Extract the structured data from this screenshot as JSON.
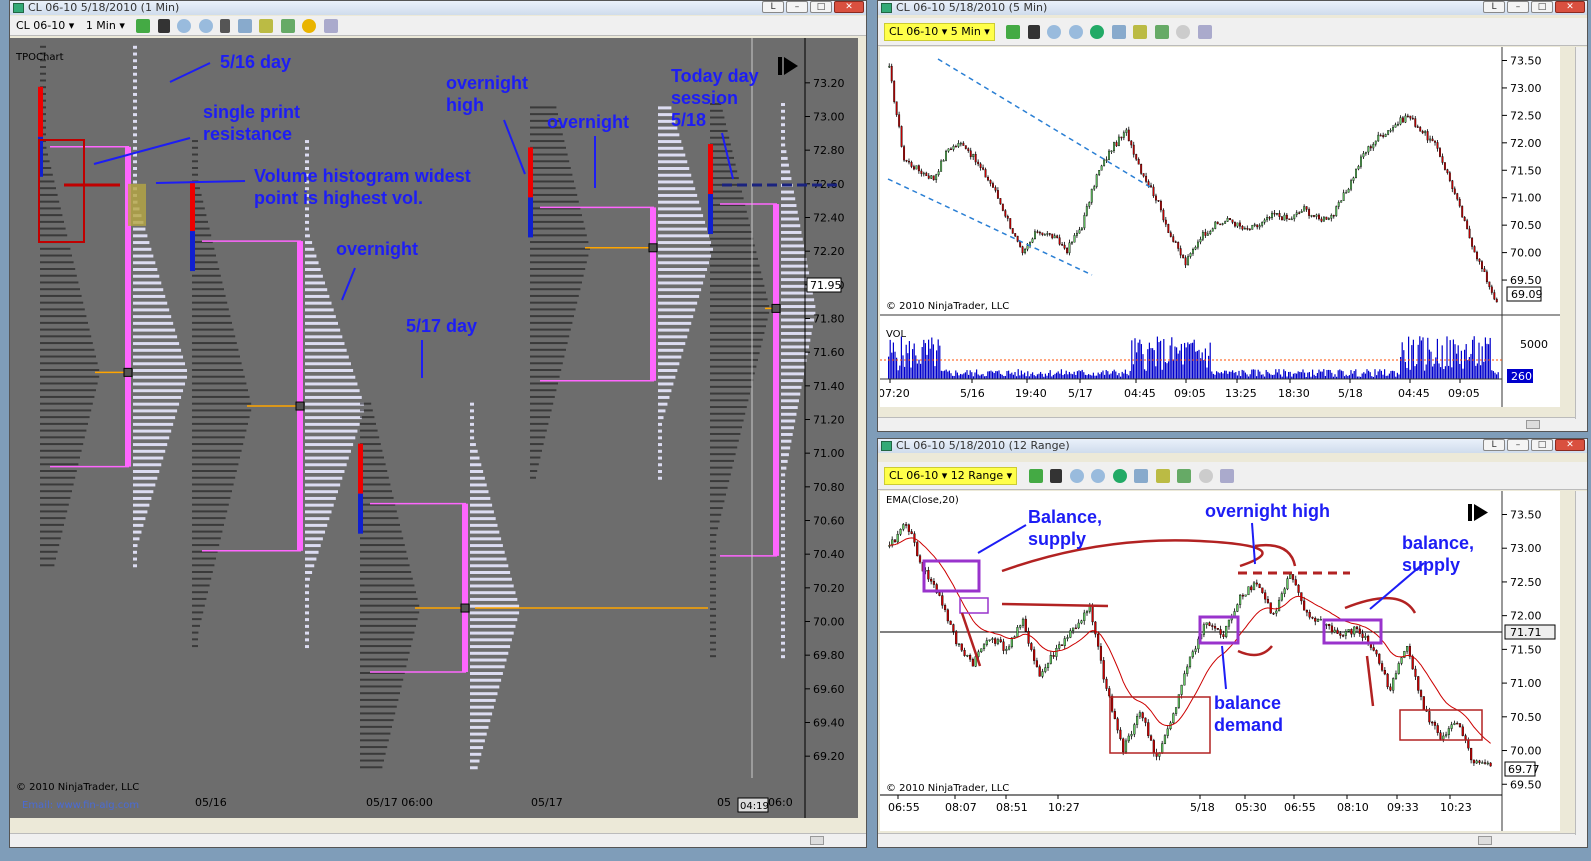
{
  "window_left": {
    "title": "CL 06-10  5/18/2010 (1 Min)",
    "instrument": "CL 06-10",
    "interval": "1 Min",
    "chart_name": "TPOChart",
    "copyright": "© 2010 NinjaTrader, LLC",
    "footer_link": "Email: www.fin-alg.com",
    "time_display": "04:19"
  },
  "window_top_right": {
    "title": "CL 06-10  5/18/2010 (5 Min)",
    "instrument": "CL 06-10",
    "interval": "5 Min",
    "copyright": "© 2010 NinjaTrader, LLC",
    "vol_label": "VOL",
    "last_price_tag": "69.09",
    "vol_tag": "260"
  },
  "window_bottom_right": {
    "title": "CL 06-10  5/18/2010 (12 Range)",
    "instrument": "CL 06-10",
    "interval": "12 Range",
    "indicator_label": "EMA(Close,20)",
    "copyright": "© 2010 NinjaTrader, LLC",
    "last_price_tag": "69.77",
    "line_tag": "71.71"
  },
  "colors": {
    "tpo_bg": "#6d6d6d",
    "value_area": "#ff66ff",
    "poc": "#ffa500",
    "annotation": "#1d1df5",
    "red_arrow": "#c00000",
    "purple_box": "#9933cc",
    "up_candle": "#66cc66",
    "down_candle": "#cc0000"
  },
  "annotations_left": [
    "5/16 day",
    "single print",
    "resistance",
    "Volume histogram widest",
    "point is highest vol.",
    "overnight",
    "5/17 day",
    "overnight",
    "high",
    "overnight",
    "Today day",
    "session",
    "5/18"
  ],
  "annotations_bottom_right": [
    "Balance,",
    "supply",
    "overnight high",
    "balance,",
    "supply",
    "balance",
    "demand"
  ],
  "chart_data": [
    {
      "type": "tpo_profile",
      "chart": "TPOChart (1 Min)",
      "y_ticks": [
        "73.20",
        "73.00",
        "72.80",
        "72.60",
        "72.40",
        "72.20",
        "72.00",
        "71.80",
        "71.60",
        "71.40",
        "71.20",
        "71.00",
        "70.80",
        "70.60",
        "70.40",
        "70.20",
        "70.00",
        "69.80",
        "69.60",
        "69.40",
        "69.20"
      ],
      "ylim": [
        69.1,
        73.3
      ],
      "x_labels": [
        "05/16",
        "05/17  06:00",
        "05/17",
        "05",
        "06:0"
      ],
      "price_tag": "71.95",
      "profiles": [
        {
          "session": "5/16 day",
          "va_high": 72.82,
          "va_low": 70.92,
          "poc": 71.48
        },
        {
          "session": "overnight",
          "va_high": 72.26,
          "va_low": 70.42,
          "poc": 71.28
        },
        {
          "session": "5/17 day",
          "va_high": 70.7,
          "va_low": 69.7,
          "poc": 70.08
        },
        {
          "session": "overnight",
          "va_high": 72.46,
          "va_low": 71.43,
          "poc": 72.22
        },
        {
          "session": "5/18",
          "va_high": 72.48,
          "va_low": 70.39,
          "poc": 71.86
        }
      ]
    },
    {
      "type": "candlestick",
      "chart": "CL 06-10 5 Min",
      "y_ticks": [
        "73.50",
        "73.00",
        "72.50",
        "72.00",
        "71.50",
        "71.00",
        "70.50",
        "70.00",
        "69.50"
      ],
      "ylim": [
        69.1,
        73.6
      ],
      "x_ticks": [
        "07:20",
        "5/16",
        "19:40",
        "5/17",
        "04:45",
        "09:05",
        "13:25",
        "18:30",
        "5/18",
        "04:45",
        "09:05"
      ],
      "close_path": [
        73.35,
        71.7,
        71.5,
        71.35,
        71.9,
        72.0,
        71.6,
        71.2,
        70.6,
        69.95,
        70.4,
        70.3,
        70.05,
        70.5,
        71.4,
        71.9,
        72.2,
        71.5,
        71.0,
        70.3,
        69.8,
        70.3,
        70.5,
        70.6,
        70.4,
        70.5,
        70.7,
        70.6,
        70.8,
        70.6,
        70.7,
        71.2,
        71.8,
        72.1,
        72.3,
        72.5,
        72.2,
        71.9,
        71.2,
        70.4,
        69.7,
        69.1
      ],
      "last": 69.09,
      "volume_ticks": [
        "5000"
      ],
      "volume_last": 260
    },
    {
      "type": "candlestick",
      "chart": "CL 06-10 12 Range",
      "y_ticks": [
        "73.50",
        "73.00",
        "72.50",
        "72.00",
        "71.50",
        "71.00",
        "70.50",
        "70.00",
        "69.50"
      ],
      "ylim": [
        69.4,
        73.7
      ],
      "x_ticks": [
        "06:55",
        "08:07",
        "08:51",
        "10:27",
        "5/18",
        "05:30",
        "06:55",
        "08:10",
        "09:33",
        "10:23"
      ],
      "close_path": [
        73.0,
        73.4,
        72.7,
        72.3,
        71.6,
        71.3,
        71.7,
        71.5,
        71.9,
        71.1,
        71.5,
        71.8,
        72.1,
        70.9,
        70.0,
        70.6,
        69.9,
        70.5,
        71.4,
        71.9,
        71.7,
        72.3,
        72.5,
        72.0,
        72.6,
        72.0,
        71.9,
        71.7,
        71.8,
        71.5,
        70.9,
        71.6,
        70.6,
        70.2,
        70.4,
        69.8,
        69.77
      ],
      "last": 69.77,
      "horizontal_line": 71.71
    }
  ]
}
